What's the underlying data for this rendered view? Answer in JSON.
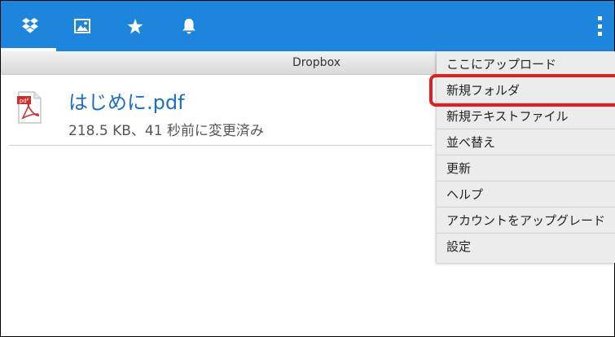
{
  "toolbar": {
    "tabs": [
      {
        "icon": "dropbox-icon"
      },
      {
        "icon": "photos-icon"
      },
      {
        "icon": "favorites-star-icon"
      },
      {
        "icon": "notifications-bell-icon"
      }
    ],
    "overflow_icon": "overflow-menu-icon",
    "bg_color": "#1d85dc"
  },
  "pathbar": {
    "label": "Dropbox"
  },
  "files": [
    {
      "name": "はじめに.pdf",
      "meta": "218.5 KB、41 秒前に変更済み",
      "icon": "pdf-file-icon"
    }
  ],
  "menu": {
    "items": [
      "ここにアップロード",
      "新規フォルダ",
      "新規テキストファイル",
      "並べ替え",
      "更新",
      "ヘルプ",
      "アカウントをアップグレード",
      "設定"
    ],
    "highlight_color": "#e02020"
  }
}
